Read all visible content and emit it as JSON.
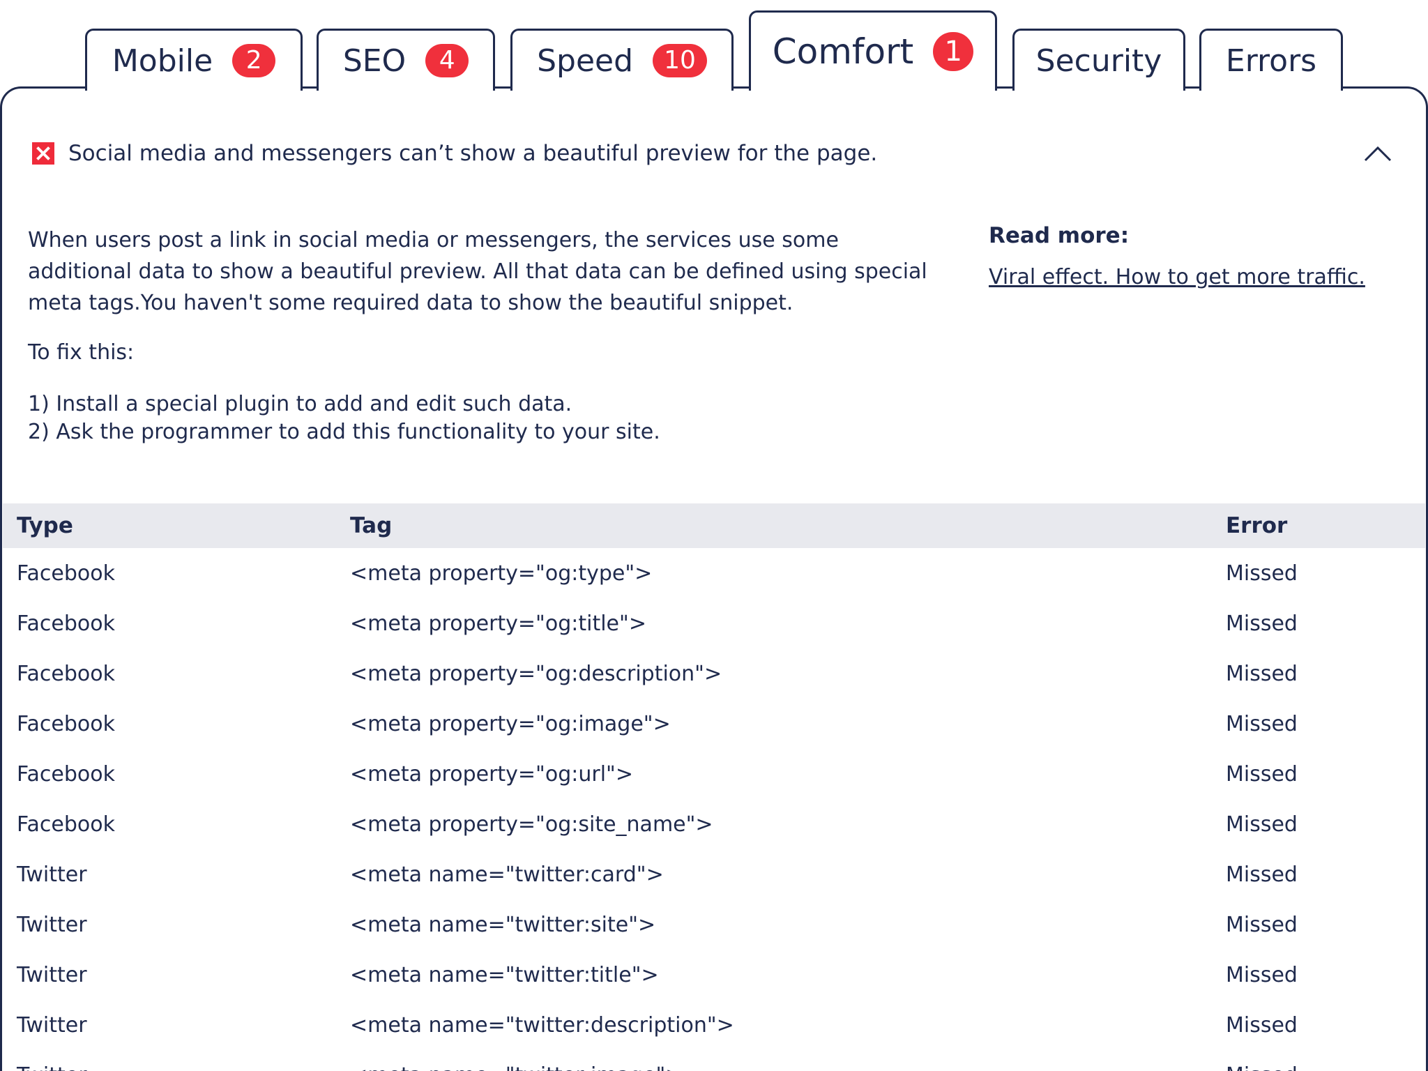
{
  "tabs": [
    {
      "label": "Mobile",
      "count": "2"
    },
    {
      "label": "SEO",
      "count": "4"
    },
    {
      "label": "Speed",
      "count": "10"
    },
    {
      "label": "Comfort",
      "count": "1"
    },
    {
      "label": "Security"
    },
    {
      "label": "Errors"
    }
  ],
  "active_tab": "Comfort",
  "issue": {
    "status": "error",
    "title": "Social media and messengers can’t show a beautiful preview for the page.",
    "description": "When users post a link in social media or messengers, the services use some additional data to show a beautiful preview. All that data can be defined using special meta tags.You haven't some required data to show the beautiful snippet.",
    "fix_label": "To fix this:",
    "fix_steps": [
      "1) Install a special plugin to add and edit such data.",
      "2) Ask the programmer to add this functionality to your site."
    ],
    "read_more_label": "Read more:",
    "read_more_link": "Viral effect. How to get more traffic."
  },
  "table": {
    "headers": [
      "Type",
      "Tag",
      "Error"
    ],
    "rows": [
      [
        "Facebook",
        "<meta property=\"og:type\">",
        "Missed"
      ],
      [
        "Facebook",
        "<meta property=\"og:title\">",
        "Missed"
      ],
      [
        "Facebook",
        "<meta property=\"og:description\">",
        "Missed"
      ],
      [
        "Facebook",
        "<meta property=\"og:image\">",
        "Missed"
      ],
      [
        "Facebook",
        "<meta property=\"og:url\">",
        "Missed"
      ],
      [
        "Facebook",
        "<meta property=\"og:site_name\">",
        "Missed"
      ],
      [
        "Twitter",
        "<meta name=\"twitter:card\">",
        "Missed"
      ],
      [
        "Twitter",
        "<meta name=\"twitter:site\">",
        "Missed"
      ],
      [
        "Twitter",
        "<meta name=\"twitter:title\">",
        "Missed"
      ],
      [
        "Twitter",
        "<meta name=\"twitter:description\">",
        "Missed"
      ],
      [
        "Twitter",
        "<meta name=\"twitter:image\">",
        "Missed"
      ]
    ]
  },
  "colors": {
    "text": "#1f2a4d",
    "badge": "#f0303c",
    "error_icon": "#ef2b3a",
    "table_header_bg": "#e8e9ee"
  },
  "icons": {
    "issue_status": "error-x-icon",
    "collapse": "chevron-up-icon"
  }
}
